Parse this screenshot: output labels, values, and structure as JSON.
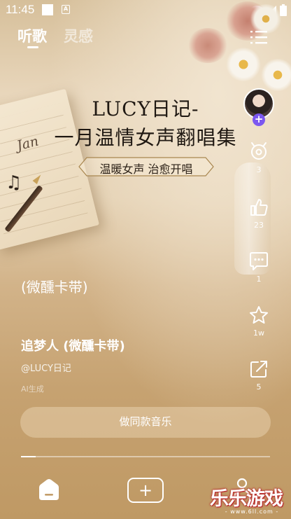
{
  "status_bar": {
    "time": "11:45",
    "icons": [
      "notification-square-icon",
      "a-icon",
      "wifi-icon",
      "signal-icon",
      "battery-icon"
    ]
  },
  "top_tabs": [
    {
      "label": "听歌",
      "active": true
    },
    {
      "label": "灵感",
      "active": false
    }
  ],
  "cover": {
    "notebook_text": "Jan",
    "title_line1": "LUCY日记-",
    "title_line2": "一月温情女声翻唱集",
    "tag": "温暖女声 治愈开唱"
  },
  "rail": {
    "follow_icon": "plus-icon",
    "items": [
      {
        "icon": "remix-icon",
        "count": "3"
      },
      {
        "icon": "thumbs-up-icon",
        "count": "23"
      },
      {
        "icon": "comment-icon",
        "count": "1"
      },
      {
        "icon": "star-icon",
        "count": "1w"
      },
      {
        "icon": "share-icon",
        "count": "5"
      }
    ]
  },
  "song": {
    "lyric": "(微醺卡带)",
    "title": "追梦人 (微醺卡带)",
    "author": "@LUCY日记",
    "ai_label": "AI生成",
    "make_button": "做同款音乐"
  },
  "progress": 0.06,
  "bottom_nav": {
    "items": [
      "home-icon",
      "add-icon",
      "profile-icon"
    ],
    "add_symbol": "+"
  },
  "watermark": {
    "main": "乐乐游戏",
    "sub": "- www.6ll.com -"
  },
  "colors": {
    "accent": "#7b57f0",
    "background_top": "#d6bf9a",
    "background_bottom": "#bf9964"
  }
}
